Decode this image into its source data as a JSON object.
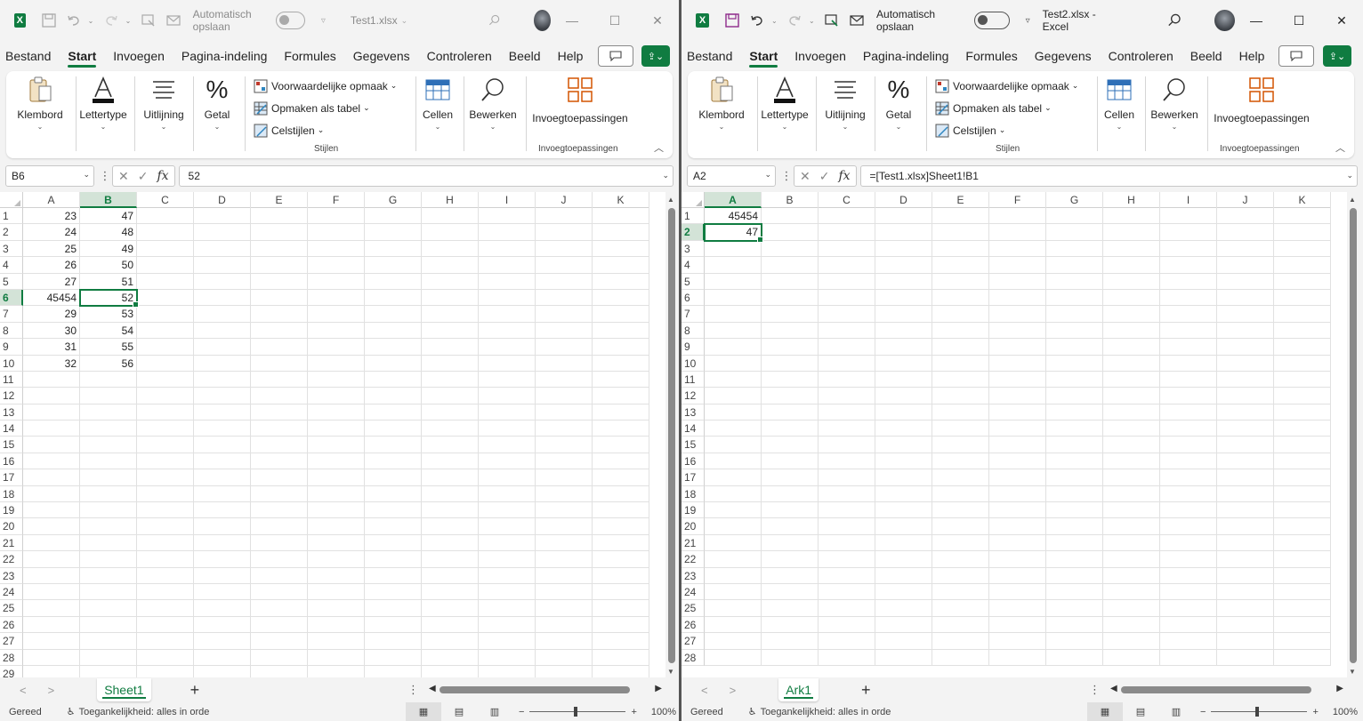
{
  "colors": {
    "excel_green": "#107c41",
    "selection_fill": "#d3e3d7",
    "grid_line": "#e1e1e1"
  },
  "menu_tabs": [
    "Bestand",
    "Start",
    "Invoegen",
    "Pagina-indeling",
    "Formules",
    "Gegevens",
    "Controleren",
    "Beeld",
    "Help"
  ],
  "ribbon": {
    "klembord": "Klembord",
    "lettertype": "Lettertype",
    "uitlijning": "Uitlijning",
    "getal": "Getal",
    "voorwaardelijke": "Voorwaardelijke opmaak",
    "opmaken_tabel": "Opmaken als tabel",
    "celstijlen": "Celstijlen",
    "stijlen_group": "Stijlen",
    "cellen": "Cellen",
    "bewerken": "Bewerken",
    "invoeg": "Invoegtoepassingen",
    "invoeg_group": "Invoegtoepassingen"
  },
  "autosave_label": "Automatisch opslaan",
  "status": {
    "ready": "Gereed",
    "accessibility": "Toegankelijkheid: alles in orde",
    "zoom": "100%"
  },
  "left": {
    "filename": "Test1.xlsx",
    "namebox": "B6",
    "formula": "52",
    "sheet_tab": "Sheet1",
    "columns": [
      "A",
      "B",
      "C",
      "D",
      "E",
      "F",
      "G",
      "H",
      "I",
      "J",
      "K"
    ],
    "row_count": 29,
    "active_cell": [
      6,
      1
    ],
    "cells": {
      "1": [
        "23",
        "47"
      ],
      "2": [
        "24",
        "48"
      ],
      "3": [
        "25",
        "49"
      ],
      "4": [
        "26",
        "50"
      ],
      "5": [
        "27",
        "51"
      ],
      "6": [
        "45454",
        "52"
      ],
      "7": [
        "29",
        "53"
      ],
      "8": [
        "30",
        "54"
      ],
      "9": [
        "31",
        "55"
      ],
      "10": [
        "32",
        "56"
      ]
    }
  },
  "right": {
    "filename": "Test2.xlsx  -  Excel",
    "namebox": "A2",
    "formula": "=[Test1.xlsx]Sheet1!B1",
    "sheet_tab": "Ark1",
    "columns": [
      "A",
      "B",
      "C",
      "D",
      "E",
      "F",
      "G",
      "H",
      "I",
      "J",
      "K"
    ],
    "row_count": 28,
    "active_cell": [
      2,
      0
    ],
    "cells": {
      "1": [
        "45454"
      ],
      "2": [
        "47"
      ]
    }
  }
}
